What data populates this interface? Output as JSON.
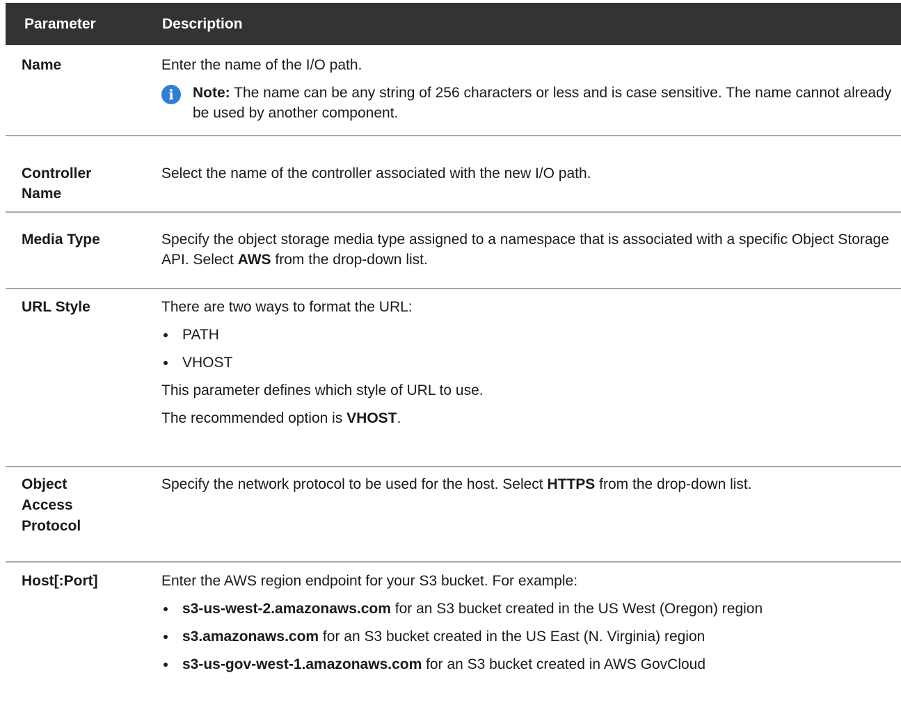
{
  "header": {
    "parameter": "Parameter",
    "description": "Description"
  },
  "rows": [
    {
      "name": "Name",
      "desc": "Enter the name of the I/O path.",
      "note_label": "Note:",
      "note_text": " The name can be any string of 256 characters or less and is case sensitive. The name cannot already be used by another component."
    },
    {
      "name_l1": "Controller",
      "name_l2": "Name",
      "desc": "Select the name of the controller associated with the new I/O path."
    },
    {
      "name": "Media Type",
      "desc_pre": "Specify the object storage media type assigned to a namespace that is associated with a specific Object Storage API. Select ",
      "desc_bold": "AWS",
      "desc_post": " from the drop-down list."
    },
    {
      "name": "URL Style",
      "intro": "There are two ways to format the URL:",
      "options": [
        "PATH",
        "VHOST"
      ],
      "p2": "This parameter defines which style of URL to use.",
      "p3_pre": "The recommended option is ",
      "p3_bold": "VHOST",
      "p3_post": "."
    },
    {
      "name_l1": "Object",
      "name_l2": "Access",
      "name_l3": "Protocol",
      "desc_pre": "Specify the network protocol to be used for the host. Select ",
      "desc_bold": "HTTPS",
      "desc_post": " from the drop-down list."
    },
    {
      "name": "Host[:Port]",
      "intro": "Enter the AWS region endpoint for your S3 bucket. For example:",
      "endpoints": [
        {
          "host": "s3-us-west-2.amazonaws.com",
          "text": " for an S3 bucket created in the US West (Oregon) region"
        },
        {
          "host": "s3.amazonaws.com",
          "text": " for an S3 bucket created in the US East (N. Virginia) region"
        },
        {
          "host": "s3-us-gov-west-1.amazonaws.com",
          "text": " for an S3 bucket created in AWS GovCloud"
        }
      ]
    }
  ],
  "colors": {
    "header_bg": "#333333",
    "header_text": "#ffffff",
    "divider": "#a8a8a8",
    "info_icon": "#2f7fd4"
  },
  "icons": {
    "note": "info-icon"
  }
}
